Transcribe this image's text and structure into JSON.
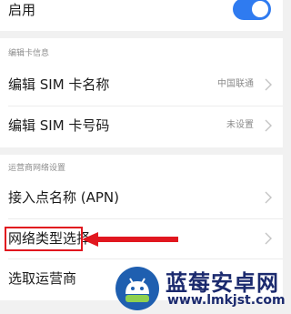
{
  "top": {
    "enable_label": "启用",
    "toggle_on": true,
    "accent": "#2f7bf0"
  },
  "sim_section": {
    "header": "编辑卡信息",
    "rows": [
      {
        "label": "编辑 SIM 卡名称",
        "value": "中国联通"
      },
      {
        "label": "编辑 SIM 卡号码",
        "value": "未设置"
      }
    ]
  },
  "carrier_section": {
    "header": "运营商网络设置",
    "rows": [
      {
        "label": "接入点名称 (APN)",
        "value": ""
      },
      {
        "label": "网络类型选择",
        "value": ""
      },
      {
        "label": "选取运营商",
        "value": ""
      }
    ]
  },
  "annotation": {
    "color": "#e1171f"
  },
  "watermark": {
    "title": "蓝莓安卓网",
    "url": "www.lmkjst.com",
    "color": "#1b2a6e"
  }
}
